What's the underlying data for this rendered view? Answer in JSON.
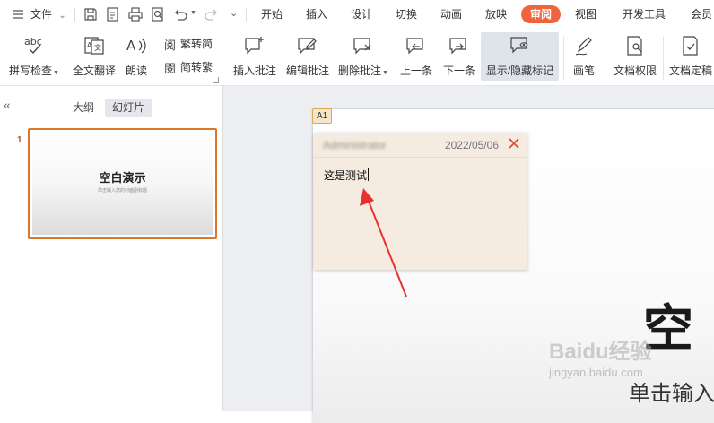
{
  "menubar": {
    "file_label": "文件",
    "tabs": [
      "开始",
      "插入",
      "设计",
      "切换",
      "动画",
      "放映",
      "审阅",
      "视图",
      "开发工具",
      "会员"
    ],
    "active_tab": "审阅"
  },
  "ribbon": {
    "spellcheck": "拼写检查",
    "translate": "全文翻译",
    "read_aloud": "朗读",
    "trad_to_simp": "繁转简",
    "simp_to_trad": "简转繁",
    "insert_comment": "插入批注",
    "edit_comment": "编辑批注",
    "delete_comment": "删除批注",
    "prev": "上一条",
    "next": "下一条",
    "show_hide_markup": "显示/隐藏标记",
    "pen": "画笔",
    "doc_permission": "文档权限",
    "doc_finalize": "文档定稿"
  },
  "panel": {
    "outline_tab": "大纲",
    "slides_tab": "幻灯片",
    "slide_number": "1",
    "thumb_title": "空白演示",
    "thumb_subtitle": "单击输入您的封面副标题"
  },
  "slide": {
    "title_partial": "空",
    "subtitle_partial": "单击输入"
  },
  "comment": {
    "marker": "A1",
    "author": "Administrator",
    "date": "2022/05/06",
    "text": "这是测试"
  },
  "watermark": {
    "brand": "Baidu经验",
    "url": "jingyan.baidu.com"
  },
  "colors": {
    "accent": "#f0643c",
    "arrow": "#e8312f",
    "comment_bg": "#f5ebe1"
  }
}
